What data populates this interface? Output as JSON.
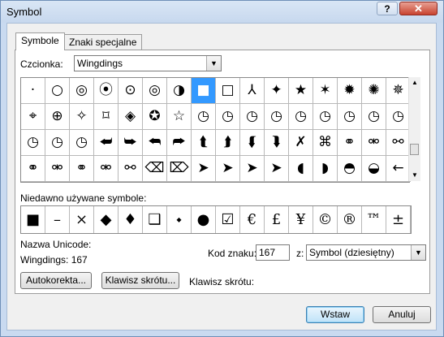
{
  "window": {
    "title": "Symbol",
    "help_label": "?",
    "close_label": "✕"
  },
  "tabs": [
    {
      "label": "Symbole"
    },
    {
      "label": "Znaki specjalne"
    }
  ],
  "font": {
    "label": "Czcionka:",
    "value": "Wingdings"
  },
  "symbols_grid": {
    "rows": [
      [
        "·",
        "○",
        "◎",
        "⦿",
        "⊙",
        "◎",
        "◑",
        "■",
        "□",
        "⅄",
        "✦",
        "★",
        "✶",
        "✹",
        "✺",
        "✵"
      ],
      [
        "⌖",
        "⊕",
        "✧",
        "⌑",
        "◈",
        "✪",
        "☆",
        "◷",
        "◷",
        "◷",
        "◷",
        "◷",
        "◷",
        "◷",
        "◷",
        "◷"
      ],
      [
        "◷",
        "◷",
        "◷",
        "⮨",
        "⮩",
        "⮪",
        "⮫",
        "⮬",
        "⮭",
        "⮮",
        "⮯",
        "✗",
        "⌘",
        "⚭",
        "⚮",
        "⚯"
      ],
      [
        "⚭",
        "⚮",
        "⚭",
        "⚮",
        "⚯",
        "⌫",
        "⌦",
        "➤",
        "➤",
        "➤",
        "➤",
        "◖",
        "◗",
        "◓",
        "◒",
        "←"
      ]
    ],
    "selected": {
      "row": 0,
      "col": 7
    }
  },
  "recent": {
    "label": "Niedawno używane symbole:",
    "symbols": [
      "■",
      "–",
      "×",
      "◆",
      "♦",
      "❑",
      "⬩",
      "●",
      "☑",
      "€",
      "£",
      "¥",
      "©",
      "®",
      "™",
      "±"
    ]
  },
  "unicode": {
    "name_label": "Nazwa Unicode:",
    "name_value": "Wingdings: 167"
  },
  "char_code": {
    "label": "Kod znaku:",
    "value": "167"
  },
  "from": {
    "label": "z:",
    "value": "Symbol (dziesiętny)"
  },
  "buttons": {
    "autocorrect": "Autokorekta...",
    "shortcut_key": "Klawisz skrótu...",
    "insert": "Wstaw",
    "cancel": "Anuluj"
  },
  "shortcut": {
    "label": "Klawisz skrótu:"
  }
}
